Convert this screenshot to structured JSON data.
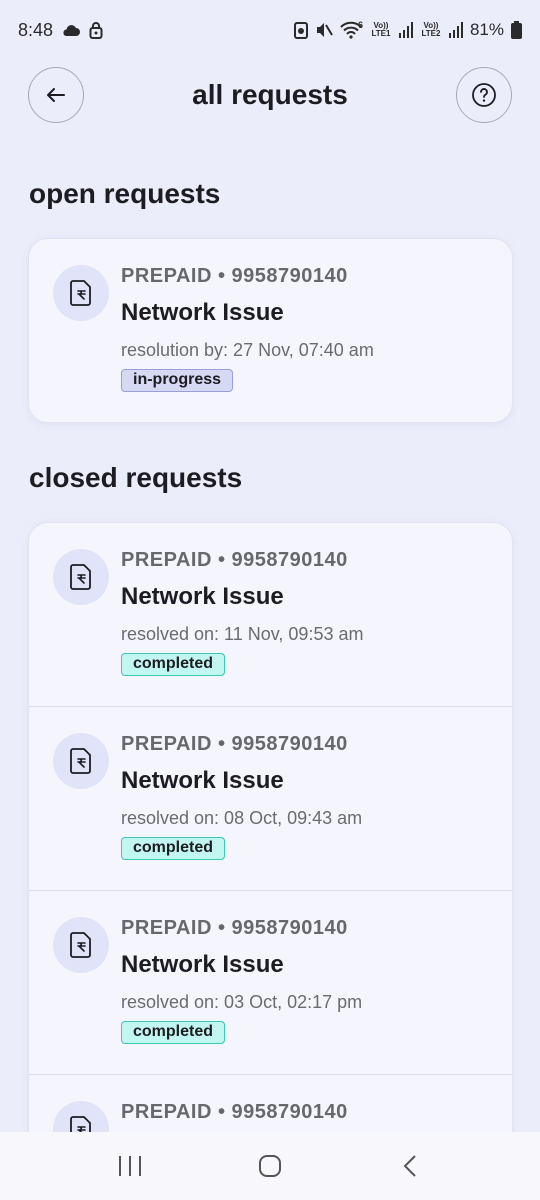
{
  "status_bar": {
    "time": "8:48",
    "battery": "81%",
    "sim1_label": "Vo)) LTE1",
    "sim2_label": "Vo)) LTE2",
    "wifi_badge": "6"
  },
  "header": {
    "title": "all requests"
  },
  "open_section": {
    "title": "open requests",
    "items": [
      {
        "meta": "PREPAID • 9958790140",
        "title": "Network Issue",
        "date": "resolution by: 27 Nov, 07:40 am",
        "status": "in-progress"
      }
    ]
  },
  "closed_section": {
    "title": "closed requests",
    "items": [
      {
        "meta": "PREPAID • 9958790140",
        "title": "Network Issue",
        "date": "resolved on: 11 Nov, 09:53 am",
        "status": "completed"
      },
      {
        "meta": "PREPAID • 9958790140",
        "title": "Network Issue",
        "date": "resolved on: 08 Oct, 09:43 am",
        "status": "completed"
      },
      {
        "meta": "PREPAID • 9958790140",
        "title": "Network Issue",
        "date": "resolved on: 03 Oct, 02:17 pm",
        "status": "completed"
      },
      {
        "meta": "PREPAID • 9958790140"
      }
    ]
  },
  "colors": {
    "background": "#ecedfb",
    "in_progress_badge": "#d6d8f4",
    "completed_badge": "#c2f6f1"
  }
}
